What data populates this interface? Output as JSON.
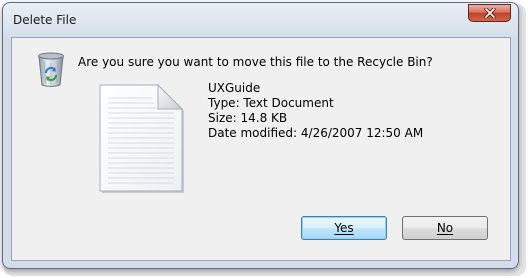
{
  "window": {
    "title": "Delete File",
    "close_icon": "close-icon"
  },
  "dialog": {
    "question": "Are you sure you want to move this file to the Recycle Bin?",
    "icon": "recycle-bin-icon"
  },
  "file": {
    "icon": "text-document-icon",
    "name": "UXGuide",
    "type": "Type: Text Document",
    "size": "Size: 14.8 KB",
    "date_modified": "Date modified: 4/26/2007 12:50 AM"
  },
  "buttons": {
    "yes_label": "Yes",
    "no_label": "No",
    "default": "yes"
  },
  "colors": {
    "close_button": "#c1422b",
    "default_button_border": "#3c7fb1",
    "dialog_background": "#f0f0f0"
  }
}
